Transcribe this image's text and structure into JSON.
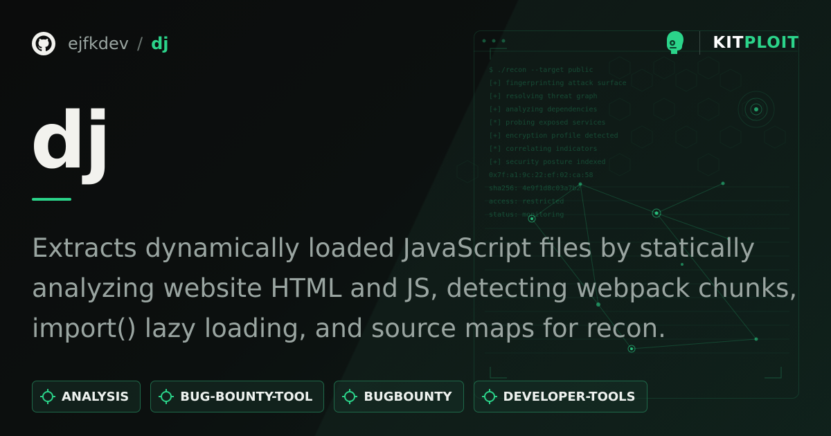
{
  "header": {
    "owner": "ejfkdev",
    "separator": "/",
    "repo": "dj"
  },
  "brand": {
    "kit": "KIT",
    "ploit": "PLOIT"
  },
  "title": "dj",
  "description": "Extracts dynamically loaded JavaScript files by statically analyzing website HTML and JS, detecting webpack chunks, import() lazy loading, and source maps for recon.",
  "tags": [
    {
      "label": "ANALYSIS"
    },
    {
      "label": "BUG-BOUNTY-TOOL"
    },
    {
      "label": "BUGBOUNTY"
    },
    {
      "label": "DEVELOPER-TOOLS"
    }
  ],
  "terminal": {
    "lines": [
      "$ ./recon --target public",
      "[+] fingerprinting attack surface",
      "[+] resolving threat graph",
      "[+] analyzing dependencies",
      "[*] probing exposed services",
      "[+] encryption profile detected",
      "[*] correlating indicators",
      "[+] security posture indexed",
      "0x7f:a1:9c:22:ef:02:ca:58",
      "sha256: 4e9f1d8c03a7b2",
      "access: restricted",
      "status: monitoring"
    ]
  },
  "colors": {
    "accent": "#2bd48a",
    "title": "#f2f2ee",
    "muted": "#9aa5a1"
  },
  "icons": {
    "repo_host": "github-icon",
    "brand": "kitploit-mascot-icon",
    "tag": "crosshair-icon"
  }
}
